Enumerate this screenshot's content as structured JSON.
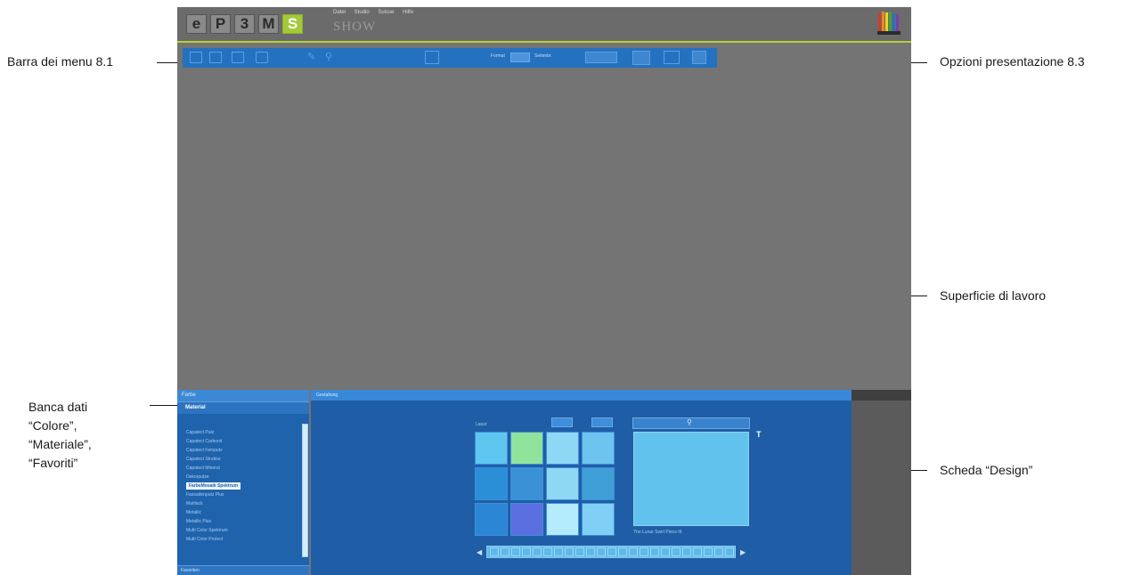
{
  "annotations": {
    "menu_bar": "Barra dei menu 8.1",
    "presentation_options": "Opzioni presentazione 8.3",
    "work_surface": "Superficie di lavoro",
    "database_lines": [
      "Banca dati",
      "“Colore”,",
      "“Materiale”,",
      "“Favoriti”"
    ],
    "design_tab": "Scheda “Design”"
  },
  "app": {
    "logo_letters": [
      "e",
      "P",
      "3",
      "M",
      "S"
    ],
    "menu": [
      "Datei",
      "Studio",
      "Suisse",
      "Hilfe"
    ],
    "show_label": "SHOW"
  },
  "toolbar": {
    "zoom_label": "Format",
    "zoom_unit": "Seitenbr."
  },
  "left_panel": {
    "tab": "Farbe",
    "section": "Material",
    "items": [
      "Capatect Putz",
      "Capatect Carbonit",
      "Capatect Feinputz",
      "Capatect Struktur",
      "Capatect Mineral",
      "Dekorputze",
      "FarbeMosaik Spektrum",
      "Fassadenputz Plus",
      "Mattlack",
      "Metallic",
      "Metallic Plus",
      "Multi Color Spektrum",
      "Multi Color Protect"
    ],
    "selected_index": 6,
    "footer": "Favoriten"
  },
  "main_panel": {
    "tab": "Gestaltung",
    "design_label": "Lasur",
    "preview_caption": "The Lunar Swirl Piece III",
    "swatches": [
      "#5fc6ef",
      "#8fe39b",
      "#8ed8f6",
      "#6dc4ee",
      "#2a8fd6",
      "#3a91d6",
      "#8fd8f4",
      "#3ea0d6",
      "#2b87d6",
      "#5b6fe0",
      "#b4ecfb",
      "#7fd0f4"
    ]
  },
  "colors": {
    "accent_green": "#b3d234",
    "toolbar_blue": "#2471c0",
    "panel_blue": "#1f63ad"
  }
}
